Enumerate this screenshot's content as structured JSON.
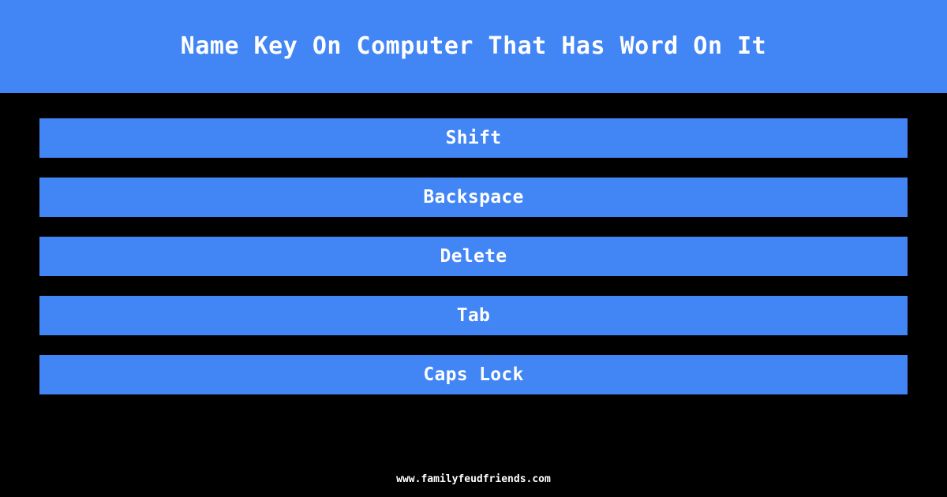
{
  "header": {
    "title": "Name Key On Computer That Has Word On It",
    "background_color": "#4285f4",
    "text_color": "#ffffff"
  },
  "page": {
    "background_color": "#000000"
  },
  "answers": {
    "bar_color": "#4285f4",
    "text_color": "#ffffff",
    "items": [
      {
        "label": "Shift"
      },
      {
        "label": "Backspace"
      },
      {
        "label": "Delete"
      },
      {
        "label": "Tab"
      },
      {
        "label": "Caps Lock"
      }
    ]
  },
  "footer": {
    "text": "www.familyfeudfriends.com",
    "text_color": "#ffffff"
  }
}
